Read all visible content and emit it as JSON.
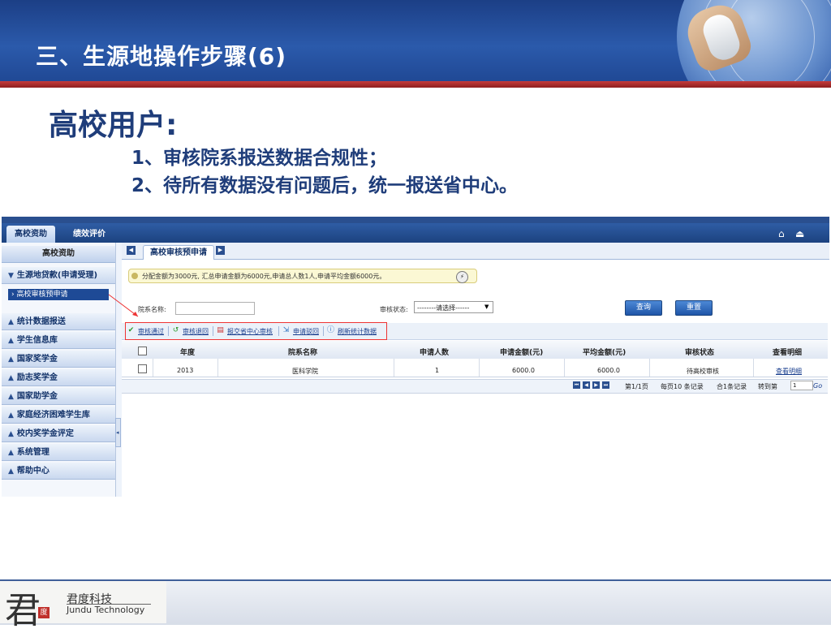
{
  "slide": {
    "title": "三、生源地操作步骤(6)",
    "subtitle": "高校用户:",
    "points": [
      "1、审核院系报送数据合规性；",
      "2、待所有数据没有问题后，统一报送省中心。"
    ]
  },
  "app": {
    "top_tabs": [
      "高校资助",
      "绩效评价"
    ],
    "sidebar": {
      "header": "高校资助",
      "items": [
        {
          "label": "生源地贷款(申请受理)",
          "expanded": true
        },
        {
          "label": "统计数据报送"
        },
        {
          "label": "学生信息库"
        },
        {
          "label": "国家奖学金"
        },
        {
          "label": "励志奖学金"
        },
        {
          "label": "国家助学金"
        },
        {
          "label": "家庭经济困难学生库"
        },
        {
          "label": "校内奖学金评定"
        },
        {
          "label": "系统管理"
        },
        {
          "label": "帮助中心"
        }
      ],
      "sub_item": "高校审核预申请"
    },
    "active_tab": "高校审核预申请",
    "notice": "分配金额为3000元, 汇总申请金额为6000元,申请总人数1人,申请平均金额6000元。",
    "search": {
      "name_label": "院系名称:",
      "name_value": "",
      "status_label": "审核状态:",
      "status_value": "--------请选择------",
      "query_label": "查询",
      "reset_label": "重置"
    },
    "toolbar": [
      "审核通过",
      "审核退回",
      "报交省中心审核",
      "申请驳回",
      "刷新统计数据"
    ],
    "table": {
      "columns": [
        "年度",
        "院系名称",
        "申请人数",
        "申请金额(元)",
        "平均金额(元)",
        "审核状态",
        "查看明细"
      ],
      "rows": [
        {
          "year": "2013",
          "dept": "医科学院",
          "count": "1",
          "amount": "6000.0",
          "avg": "6000.0",
          "status": "待高校审核",
          "detail": "查看明细"
        }
      ]
    },
    "pager": {
      "page": "第1/1页",
      "per_page": "每页10 条记录",
      "total": "合1条记录",
      "jump_label": "转到第",
      "jump_value": "1",
      "go": "Go"
    }
  },
  "footer": {
    "logo_char": "君",
    "seal_char": "度",
    "company_cn": "君度科技",
    "company_en": "Jundu Technology"
  },
  "colors": {
    "header_blue": "#2b5aab",
    "accent_red": "#c53b3b",
    "title_text": "#1f3d7a"
  }
}
